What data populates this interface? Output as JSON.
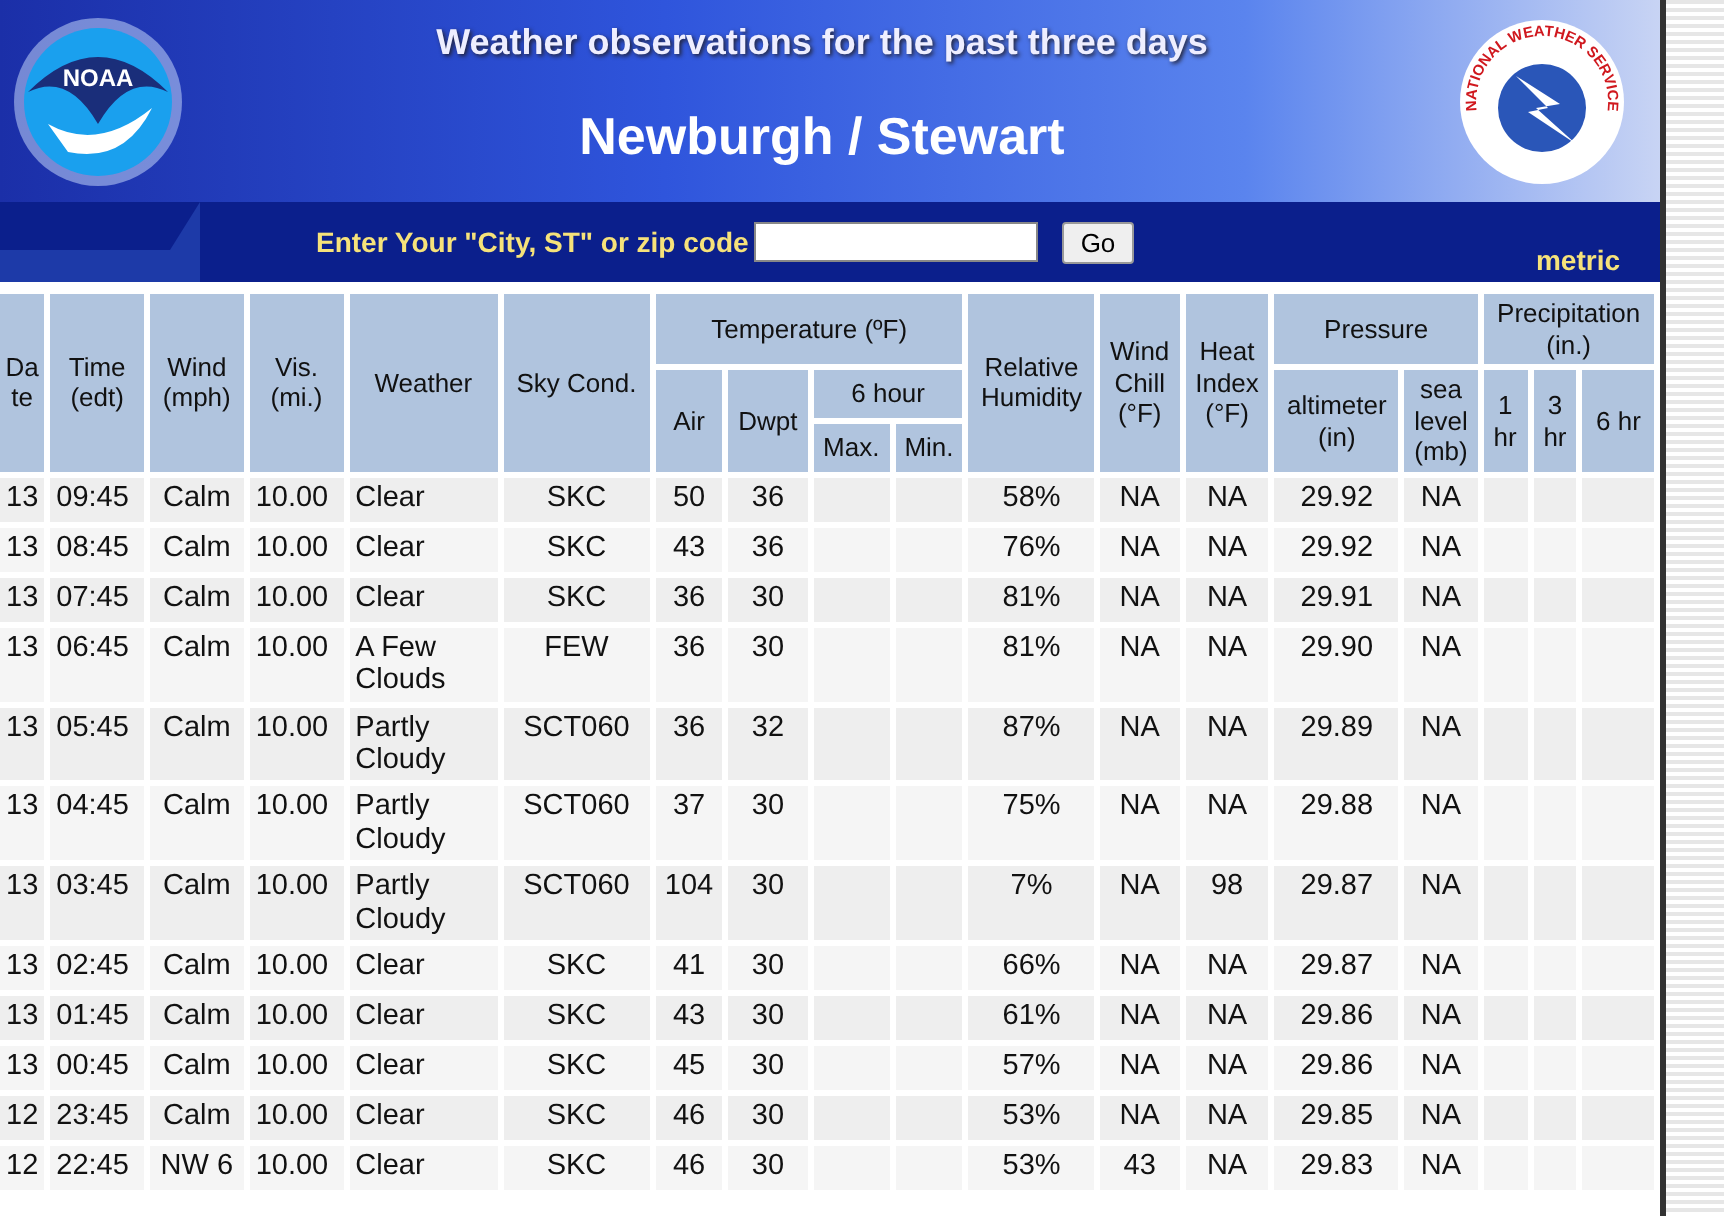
{
  "banner": {
    "noaa_logo_text": "NOAA",
    "subtitle": "Weather observations for the past three days",
    "title": "Newburgh / Stewart",
    "nws_logo_text": "NATIONAL WEATHER SERVICE"
  },
  "search": {
    "label": "Enter Your \"City, ST\" or zip code",
    "button": "Go"
  },
  "units_link": "metric",
  "table": {
    "columns": [
      {
        "label": "Date"
      },
      {
        "label": "Time\n(edt)"
      },
      {
        "label": "Wind\n(mph)"
      },
      {
        "label": "Vis.\n(mi.)"
      },
      {
        "label": "Weather"
      },
      {
        "label": "Sky Cond."
      },
      {
        "label": "Temperature (ºF)",
        "children": [
          {
            "label": "Air"
          },
          {
            "label": "Dwpt"
          },
          {
            "label": "6 hour",
            "children": [
              {
                "label": "Max."
              },
              {
                "label": "Min."
              }
            ]
          }
        ]
      },
      {
        "label": "Relative\nHumidity"
      },
      {
        "label": "Wind\nChill\n(°F)"
      },
      {
        "label": "Heat\nIndex\n(°F)"
      },
      {
        "label": "Pressure",
        "children": [
          {
            "label": "altimeter\n(in)"
          },
          {
            "label": "sea\nlevel\n(mb)"
          }
        ]
      },
      {
        "label": "Precipitation\n(in.)",
        "children": [
          {
            "label": "1\nhr"
          },
          {
            "label": "3\nhr"
          },
          {
            "label": "6 hr"
          }
        ]
      }
    ],
    "rows": [
      {
        "date": "13",
        "time": "09:45",
        "wind": "Calm",
        "visibility": "10.00",
        "weather": "Clear",
        "sky": "SKC",
        "air": "50",
        "dewpoint": "36",
        "relative_humidity": "58%",
        "wind_chill": "NA",
        "heat_index": "NA",
        "altimeter": "29.92",
        "sea_level": "NA"
      },
      {
        "date": "13",
        "time": "08:45",
        "wind": "Calm",
        "visibility": "10.00",
        "weather": "Clear",
        "sky": "SKC",
        "air": "43",
        "dewpoint": "36",
        "relative_humidity": "76%",
        "wind_chill": "NA",
        "heat_index": "NA",
        "altimeter": "29.92",
        "sea_level": "NA"
      },
      {
        "date": "13",
        "time": "07:45",
        "wind": "Calm",
        "visibility": "10.00",
        "weather": "Clear",
        "sky": "SKC",
        "air": "36",
        "dewpoint": "30",
        "relative_humidity": "81%",
        "wind_chill": "NA",
        "heat_index": "NA",
        "altimeter": "29.91",
        "sea_level": "NA"
      },
      {
        "date": "13",
        "time": "06:45",
        "wind": "Calm",
        "visibility": "10.00",
        "weather": "A Few Clouds",
        "sky": "FEW",
        "air": "36",
        "dewpoint": "30",
        "relative_humidity": "81%",
        "wind_chill": "NA",
        "heat_index": "NA",
        "altimeter": "29.90",
        "sea_level": "NA"
      },
      {
        "date": "13",
        "time": "05:45",
        "wind": "Calm",
        "visibility": "10.00",
        "weather": "Partly Cloudy",
        "sky": "SCT060",
        "air": "36",
        "dewpoint": "32",
        "relative_humidity": "87%",
        "wind_chill": "NA",
        "heat_index": "NA",
        "altimeter": "29.89",
        "sea_level": "NA"
      },
      {
        "date": "13",
        "time": "04:45",
        "wind": "Calm",
        "visibility": "10.00",
        "weather": "Partly Cloudy",
        "sky": "SCT060",
        "air": "37",
        "dewpoint": "30",
        "relative_humidity": "75%",
        "wind_chill": "NA",
        "heat_index": "NA",
        "altimeter": "29.88",
        "sea_level": "NA"
      },
      {
        "date": "13",
        "time": "03:45",
        "wind": "Calm",
        "visibility": "10.00",
        "weather": "Partly Cloudy",
        "sky": "SCT060",
        "air": "104",
        "dewpoint": "30",
        "relative_humidity": "7%",
        "wind_chill": "NA",
        "heat_index": "98",
        "altimeter": "29.87",
        "sea_level": "NA"
      },
      {
        "date": "13",
        "time": "02:45",
        "wind": "Calm",
        "visibility": "10.00",
        "weather": "Clear",
        "sky": "SKC",
        "air": "41",
        "dewpoint": "30",
        "relative_humidity": "66%",
        "wind_chill": "NA",
        "heat_index": "NA",
        "altimeter": "29.87",
        "sea_level": "NA"
      },
      {
        "date": "13",
        "time": "01:45",
        "wind": "Calm",
        "visibility": "10.00",
        "weather": "Clear",
        "sky": "SKC",
        "air": "43",
        "dewpoint": "30",
        "relative_humidity": "61%",
        "wind_chill": "NA",
        "heat_index": "NA",
        "altimeter": "29.86",
        "sea_level": "NA"
      },
      {
        "date": "13",
        "time": "00:45",
        "wind": "Calm",
        "visibility": "10.00",
        "weather": "Clear",
        "sky": "SKC",
        "air": "45",
        "dewpoint": "30",
        "relative_humidity": "57%",
        "wind_chill": "NA",
        "heat_index": "NA",
        "altimeter": "29.86",
        "sea_level": "NA"
      },
      {
        "date": "12",
        "time": "23:45",
        "wind": "Calm",
        "visibility": "10.00",
        "weather": "Clear",
        "sky": "SKC",
        "air": "46",
        "dewpoint": "30",
        "relative_humidity": "53%",
        "wind_chill": "NA",
        "heat_index": "NA",
        "altimeter": "29.85",
        "sea_level": "NA"
      },
      {
        "date": "12",
        "time": "22:45",
        "wind": "NW 6",
        "visibility": "10.00",
        "weather": "Clear",
        "sky": "SKC",
        "air": "46",
        "dewpoint": "30",
        "relative_humidity": "53%",
        "wind_chill": "43",
        "heat_index": "NA",
        "altimeter": "29.83",
        "sea_level": "NA"
      }
    ]
  }
}
